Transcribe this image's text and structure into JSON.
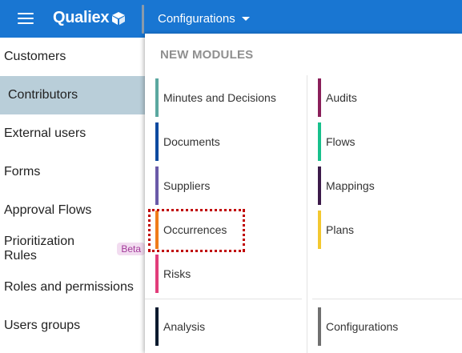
{
  "topbar": {
    "logo_text": "Qualiex",
    "menu_label": "Configurations"
  },
  "sidebar": {
    "items": [
      {
        "label": "Customers"
      },
      {
        "label": "Contributors"
      },
      {
        "label": "External users"
      },
      {
        "label": "Forms"
      },
      {
        "label": "Approval Flows"
      },
      {
        "label": "Prioritization Rules",
        "badge": "Beta"
      },
      {
        "label": "Roles and permissions"
      },
      {
        "label": "Users groups"
      }
    ]
  },
  "dropdown": {
    "header": "NEW MODULES",
    "left_modules": [
      {
        "label": "Minutes and Decisions",
        "color": "#5ba8a0"
      },
      {
        "label": "Documents",
        "color": "#0d4aa0"
      },
      {
        "label": "Suppliers",
        "color": "#6a5aa8"
      },
      {
        "label": "Occurrences",
        "color": "#f07c1a"
      },
      {
        "label": "Risks",
        "color": "#e23d7a"
      }
    ],
    "right_modules": [
      {
        "label": "Audits",
        "color": "#8a1f5a"
      },
      {
        "label": "Flows",
        "color": "#18c08c"
      },
      {
        "label": "Mappings",
        "color": "#3c1a4a"
      },
      {
        "label": "Plans",
        "color": "#f3c830"
      }
    ],
    "bottom_left": {
      "label": "Analysis",
      "color": "#0a1a2e"
    },
    "bottom_right": {
      "label": "Configurations",
      "color": "#707070"
    }
  }
}
